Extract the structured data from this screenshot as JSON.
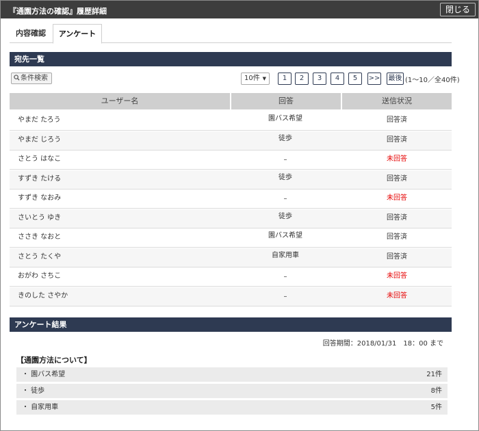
{
  "window": {
    "title": "『通園方法の確認』履歴詳細",
    "close_label": "閉じる"
  },
  "tabs": [
    {
      "label": "内容確認",
      "active": false
    },
    {
      "label": "アンケート",
      "active": true
    }
  ],
  "recipients": {
    "section_title": "宛先一覧",
    "filter_label": "条件検索",
    "per_page": "10件",
    "pages": [
      "1",
      "2",
      "3",
      "4",
      "5",
      ">>",
      "最後"
    ],
    "range_text": "(1〜10／全40件)",
    "columns": [
      "ユーザー名",
      "回答",
      "送信状況"
    ],
    "rows": [
      {
        "name": "やまだ たろう",
        "answer": "園バス希望",
        "status": "回答済",
        "status_color": "#333333"
      },
      {
        "name": "やまだ じろう",
        "answer": "徒歩",
        "status": "回答済",
        "status_color": "#333333"
      },
      {
        "name": "さとう はなこ",
        "answer": "–",
        "status": "未回答",
        "status_color": "#e60000"
      },
      {
        "name": "すずき たける",
        "answer": "徒歩",
        "status": "回答済",
        "status_color": "#333333"
      },
      {
        "name": "すずき なおみ",
        "answer": "–",
        "status": "未回答",
        "status_color": "#e60000"
      },
      {
        "name": "さいとう ゆき",
        "answer": "徒歩",
        "status": "回答済",
        "status_color": "#333333"
      },
      {
        "name": "ささき なおと",
        "answer": "園バス希望",
        "status": "回答済",
        "status_color": "#333333"
      },
      {
        "name": "さとう たくや",
        "answer": "自家用車",
        "status": "回答済",
        "status_color": "#333333"
      },
      {
        "name": "おがわ さちこ",
        "answer": "–",
        "status": "未回答",
        "status_color": "#e60000"
      },
      {
        "name": "きのした さやか",
        "answer": "–",
        "status": "未回答",
        "status_color": "#e60000"
      }
    ]
  },
  "results": {
    "section_title": "アンケート結果",
    "period": "回答期間：2018/01/31　18：00 まで",
    "question_title": "【通園方法について】",
    "items": [
      {
        "label": "・ 園バス希望",
        "count": "21件"
      },
      {
        "label": "・ 徒歩",
        "count": "8件"
      },
      {
        "label": "・ 自家用車",
        "count": "5件"
      }
    ]
  },
  "colors": {
    "titlebar": "#3d3d3d",
    "section_bar": "#2e3a52",
    "unanswered": "#e60000"
  }
}
